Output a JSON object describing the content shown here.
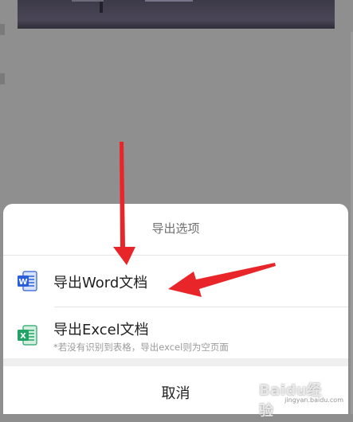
{
  "sheet": {
    "title": "导出选项",
    "word_option": {
      "label": "导出Word文档",
      "icon": "word-doc-icon"
    },
    "excel_option": {
      "label": "导出Excel文档",
      "sub": "*若没有识别到表格，导出excel则为空页面",
      "icon": "excel-doc-icon"
    },
    "cancel_label": "取消"
  },
  "watermark": {
    "brand": "Baidu经验",
    "url": "jingyan.baidu.com"
  },
  "colors": {
    "word": "#2b5fd9",
    "excel": "#21a366",
    "arrow": "#e8262a"
  }
}
